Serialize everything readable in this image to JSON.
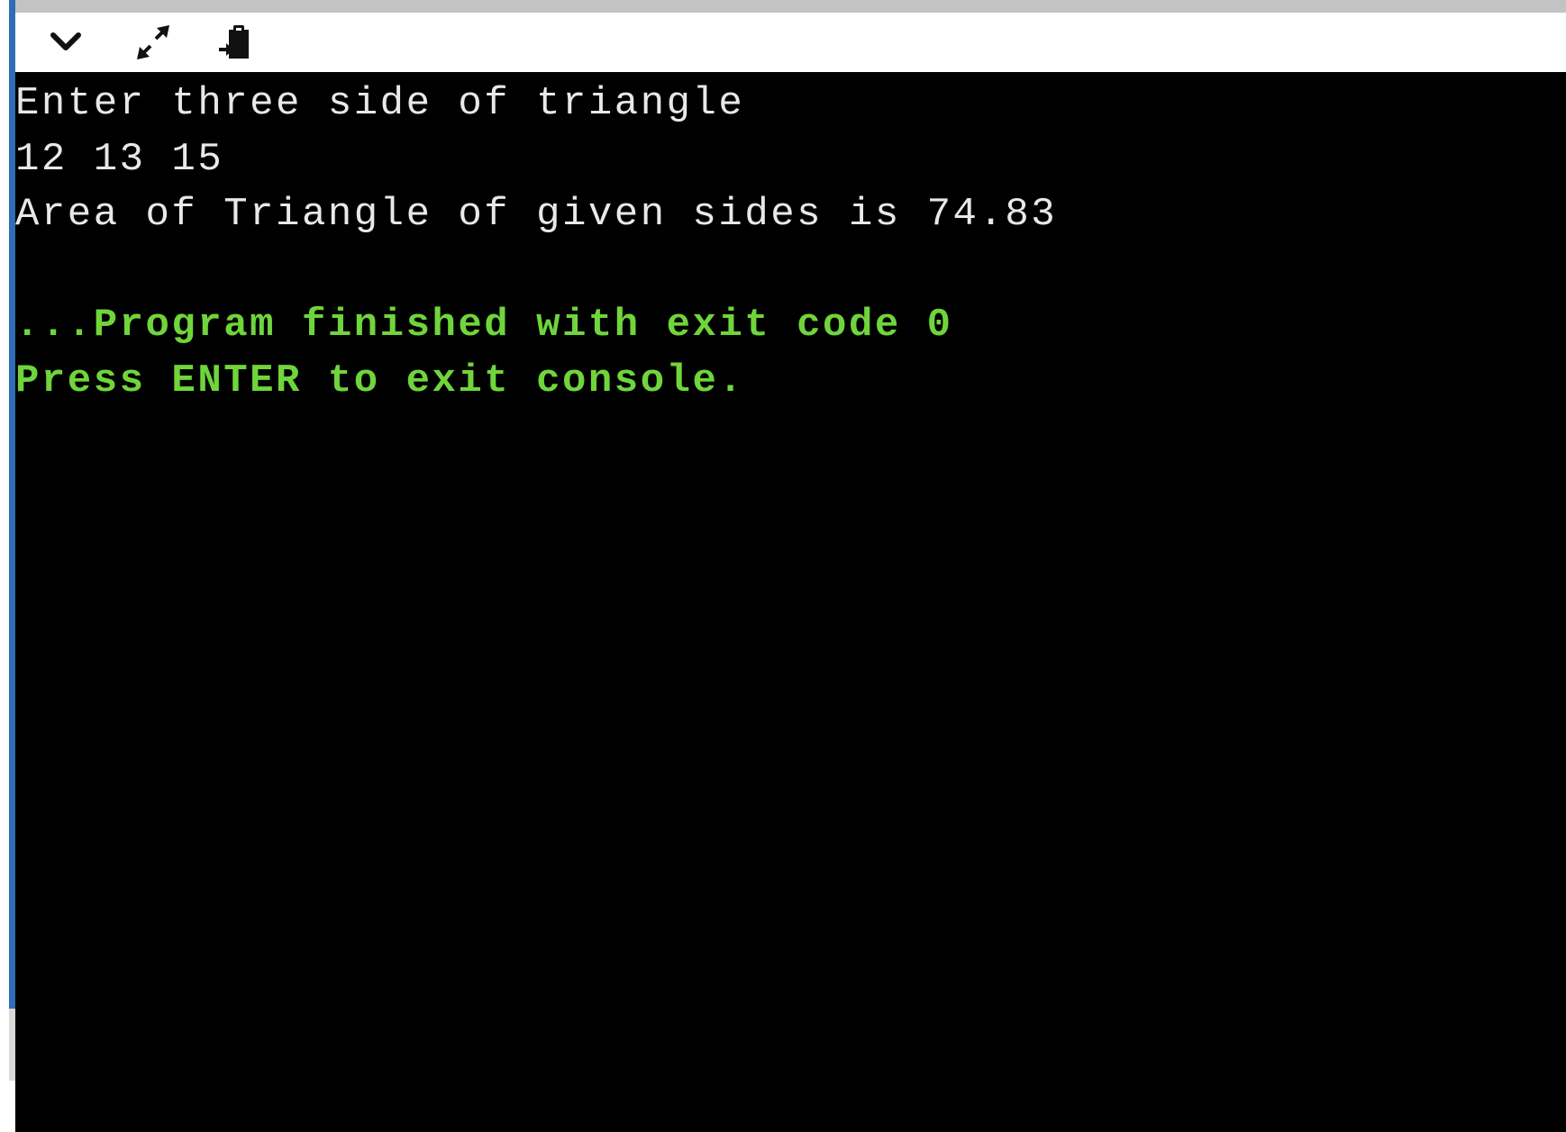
{
  "toolbar": {
    "collapse_icon": "chevron-down-icon",
    "expand_icon": "expand-arrows-icon",
    "copy_icon": "clipboard-paste-icon"
  },
  "console": {
    "prompt": "Enter three side of triangle",
    "user_input": "12 13 15",
    "result": "Area of Triangle of given sides is 74.83",
    "exit_message": "...Program finished with exit code 0",
    "press_enter": "Press ENTER to exit console."
  },
  "colors": {
    "background": "#000000",
    "text": "#e8e8e8",
    "success": "#6fd53b",
    "accent": "#2f6db6"
  }
}
